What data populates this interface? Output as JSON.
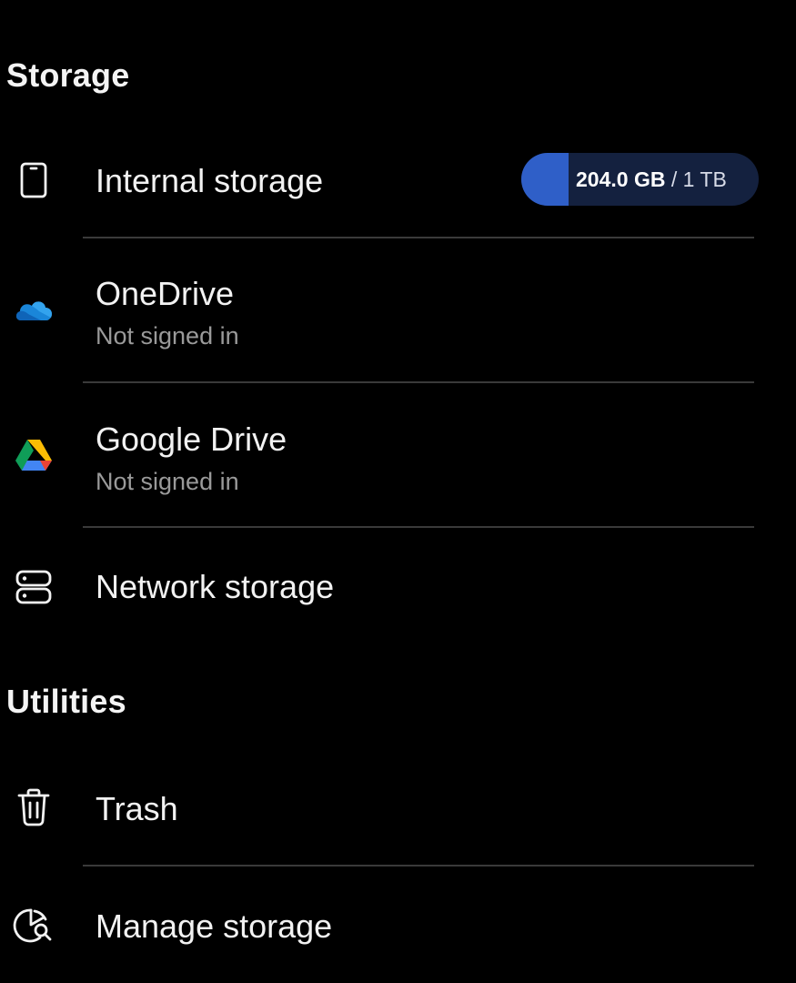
{
  "sections": {
    "storage": {
      "title": "Storage",
      "items": [
        {
          "label": "Internal storage",
          "icon": "phone-icon",
          "usage": {
            "used": "204.0 GB",
            "separator": " / ",
            "total": "1 TB",
            "fraction": 0.2
          }
        },
        {
          "label": "OneDrive",
          "sublabel": "Not signed in",
          "icon": "onedrive-icon"
        },
        {
          "label": "Google Drive",
          "sublabel": "Not signed in",
          "icon": "google-drive-icon"
        },
        {
          "label": "Network storage",
          "icon": "network-storage-icon"
        }
      ]
    },
    "utilities": {
      "title": "Utilities",
      "items": [
        {
          "label": "Trash",
          "icon": "trash-icon"
        },
        {
          "label": "Manage storage",
          "icon": "manage-storage-icon"
        }
      ]
    }
  },
  "colors": {
    "background": "#000000",
    "usage_fill": "#2f5fc8",
    "usage_track": "#14213f",
    "onedrive_blue": "#1a86d9",
    "sublabel_gray": "#9a9a9a"
  }
}
